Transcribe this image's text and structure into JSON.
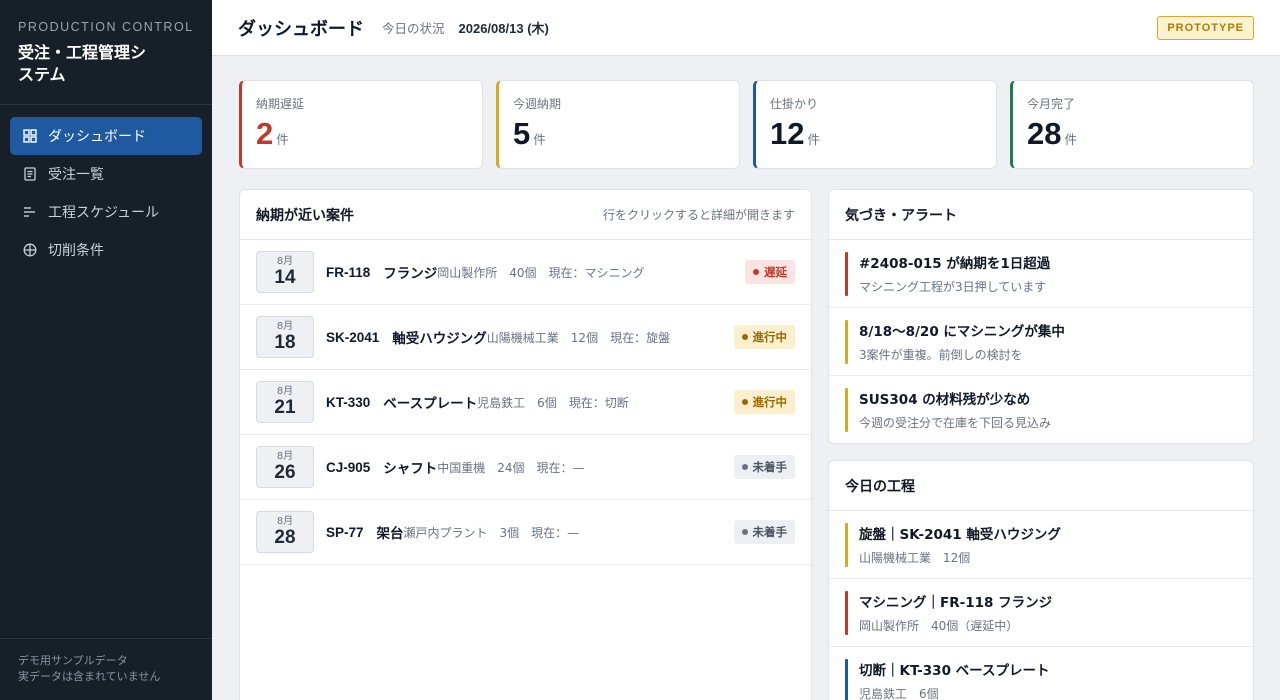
{
  "colors": {
    "red": "#c0392b",
    "yellow": "#d9a91f",
    "blue": "#1f5aa0",
    "green": "#1e7d4f"
  },
  "sidebar": {
    "brand_sub": "PRODUCTION CONTROL",
    "brand_title": "受注・工程管理システム",
    "items": [
      {
        "label": "ダッシュボード",
        "icon": "dashboard-icon",
        "active": true
      },
      {
        "label": "受注一覧",
        "icon": "document-icon",
        "active": false
      },
      {
        "label": "工程スケジュール",
        "icon": "schedule-icon",
        "active": false
      },
      {
        "label": "切削条件",
        "icon": "crosshair-icon",
        "active": false
      }
    ],
    "footer_line1": "デモ用サンプルデータ",
    "footer_line2": "実データは含まれていません"
  },
  "header": {
    "title": "ダッシュボード",
    "today_label": "今日の状況",
    "today_date": "2026/08/13 (木)",
    "badge": "PROTOTYPE"
  },
  "stats": [
    {
      "label": "納期遅延",
      "value": "2",
      "unit": "件",
      "color": "#c0392b",
      "value_color": "#c0392b"
    },
    {
      "label": "今週納期",
      "value": "5",
      "unit": "件",
      "color": "#d9a91f",
      "value_color": "#111827"
    },
    {
      "label": "仕掛かり",
      "value": "12",
      "unit": "件",
      "color": "#1f5aa0",
      "value_color": "#111827"
    },
    {
      "label": "今月完了",
      "value": "28",
      "unit": "件",
      "color": "#1e7d4f",
      "value_color": "#111827"
    }
  ],
  "due_panel": {
    "title": "納期が近い案件",
    "hint": "行をクリックすると詳細が開きます",
    "rows": [
      {
        "month": "8月",
        "day": "14",
        "code": "FR-118",
        "name": "フランジ",
        "meta": "岡山製作所　40個　現在：マシニング",
        "status": "遅延",
        "status_class": "st-late"
      },
      {
        "month": "8月",
        "day": "18",
        "code": "SK-2041",
        "name": "軸受ハウジング",
        "meta": "山陽機械工業　12個　現在：旋盤",
        "status": "進行中",
        "status_class": "st-prog"
      },
      {
        "month": "8月",
        "day": "21",
        "code": "KT-330",
        "name": "ベースプレート",
        "meta": "児島鉄工　6個　現在：切断",
        "status": "進行中",
        "status_class": "st-prog"
      },
      {
        "month": "8月",
        "day": "26",
        "code": "CJ-905",
        "name": "シャフト",
        "meta": "中国重機　24個　現在：—",
        "status": "未着手",
        "status_class": "st-wait"
      },
      {
        "month": "8月",
        "day": "28",
        "code": "SP-77",
        "name": "架台",
        "meta": "瀬戸内プラント　3個　現在：—",
        "status": "未着手",
        "status_class": "st-wait"
      }
    ]
  },
  "alert_panel": {
    "title": "気づき・アラート",
    "items": [
      {
        "title": "#2408-015 が納期を1日超過",
        "sub": "マシニング工程が3日押しています",
        "color": "#c0392b"
      },
      {
        "title": "8/18〜8/20 にマシニングが集中",
        "sub": "3案件が重複。前倒しの検討を",
        "color": "#d9a91f"
      },
      {
        "title": "SUS304 の材料残が少なめ",
        "sub": "今週の受注分で在庫を下回る見込み",
        "color": "#d9a91f"
      }
    ]
  },
  "today_panel": {
    "title": "今日の工程",
    "items": [
      {
        "title": "旋盤｜SK-2041 軸受ハウジング",
        "sub": "山陽機械工業　12個",
        "color": "#d9a91f"
      },
      {
        "title": "マシニング｜FR-118 フランジ",
        "sub": "岡山製作所　40個（遅延中）",
        "color": "#c0392b"
      },
      {
        "title": "切断｜KT-330 ベースプレート",
        "sub": "児島鉄工　6個",
        "color": "#1f5aa0"
      }
    ]
  }
}
